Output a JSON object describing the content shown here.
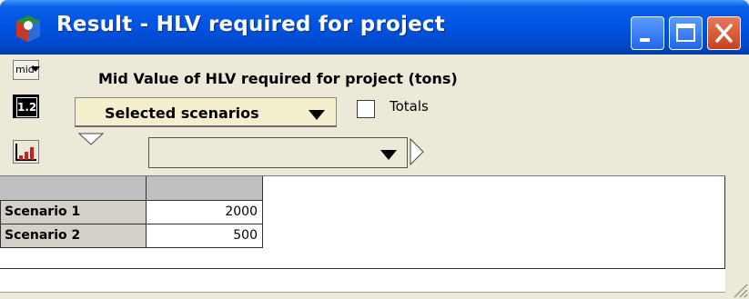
{
  "window": {
    "title": "Result - HLV required for project"
  },
  "toolbar": {
    "view_mode": "mid",
    "number_format": "1.2"
  },
  "result": {
    "title": "Mid Value of HLV required for project (tons)",
    "index_selector": "Selected scenarios",
    "totals_label": "Totals",
    "totals_checked": false,
    "row_selector": ""
  },
  "table": {
    "column_header": "",
    "rows": [
      {
        "label": "Scenario 1",
        "value": "2000"
      },
      {
        "label": "Scenario 2",
        "value": "500"
      }
    ]
  },
  "colors": {
    "titlebar": "#0054e3",
    "window_bg": "#ece9d8",
    "dropdown_bg": "#f4efcc",
    "header_cell": "#c0c0c0"
  }
}
